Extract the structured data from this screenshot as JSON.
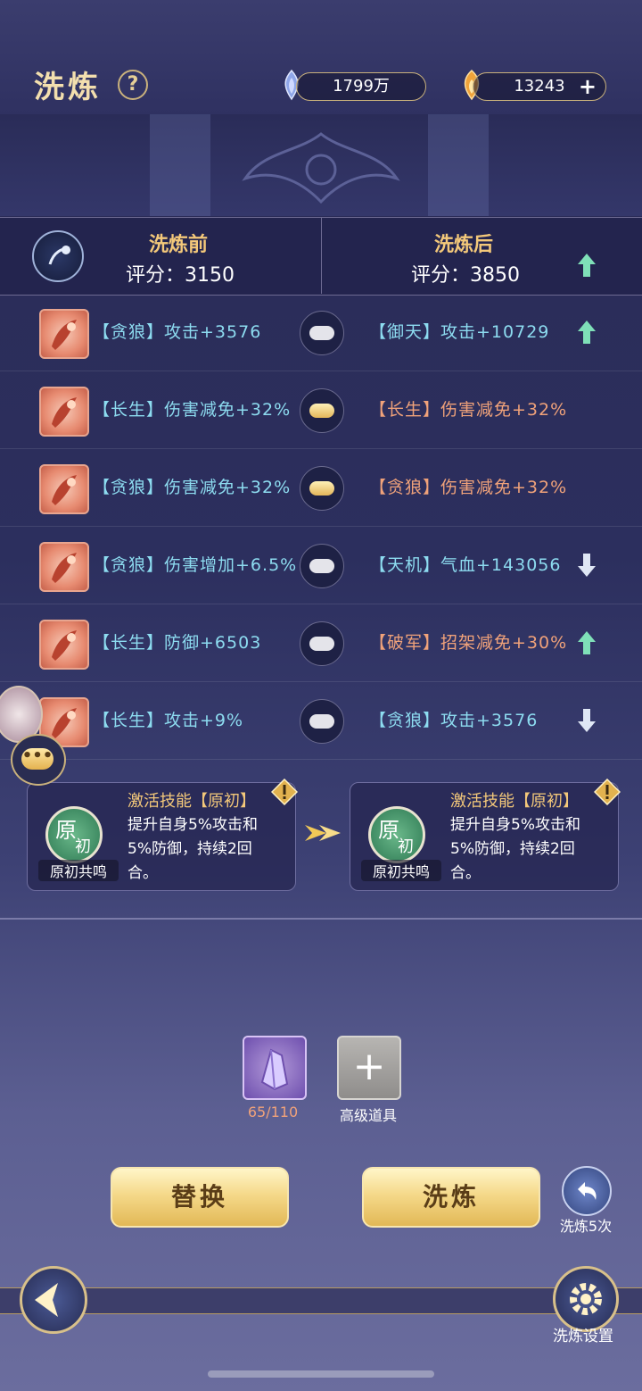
{
  "header": {
    "title": "洗炼",
    "help_glyph": "?",
    "currency1": {
      "icon": "moon-crystal-icon",
      "value": "1799万"
    },
    "currency2": {
      "icon": "flame-gem-icon",
      "value": "13243",
      "add_glyph": "+"
    }
  },
  "compare": {
    "before_title": "洗炼前",
    "after_title": "洗炼后",
    "before_score": "评分：3150",
    "after_score": "评分：3850",
    "score_trend": "up"
  },
  "rows": [
    {
      "left_tag": "【贪狼】",
      "left_text": "攻击+3576",
      "lock": "unlocked",
      "right_tag": "【御天】",
      "right_text": "攻击+10729",
      "right_tag_color": "#8ddcf0",
      "trend": "up"
    },
    {
      "left_tag": "【长生】",
      "left_text": "伤害减免+32%",
      "lock": "locked",
      "right_tag": "【长生】",
      "right_text": "伤害减免+32%",
      "right_tag_color": "#f0a27a",
      "trend": "none"
    },
    {
      "left_tag": "【贪狼】",
      "left_text": "伤害减免+32%",
      "lock": "locked",
      "right_tag": "【贪狼】",
      "right_text": "伤害减免+32%",
      "right_tag_color": "#f0a27a",
      "trend": "none"
    },
    {
      "left_tag": "【贪狼】",
      "left_text": "伤害增加+6.5%",
      "lock": "unlocked",
      "right_tag": "【天机】",
      "right_text": "气血+143056",
      "right_tag_color": "#8ddcf0",
      "trend": "down"
    },
    {
      "left_tag": "【长生】",
      "left_text": "防御+6503",
      "lock": "unlocked",
      "right_tag": "【破军】",
      "right_text": "招架减免+30%",
      "right_tag_color": "#f0a27a",
      "trend": "up"
    },
    {
      "left_tag": "【长生】",
      "left_text": "攻击+9%",
      "lock": "unlocked",
      "right_tag": "【贪狼】",
      "right_text": "攻击+3576",
      "right_tag_color": "#8ddcf0",
      "trend": "down"
    }
  ],
  "skills": {
    "before": {
      "badge_top": "原",
      "badge_bottom": "初",
      "name": "原初共鸣",
      "title": "激活技能【原初】",
      "desc": "提升自身5%攻击和5%防御，持续2回合。"
    },
    "after": {
      "badge_top": "原",
      "badge_bottom": "初",
      "name": "原初共鸣",
      "title": "激活技能【原初】",
      "desc": "提升自身5%攻击和5%防御，持续2回合。"
    }
  },
  "materials": {
    "crystal_count": "65/110",
    "advanced_label": "高级道具",
    "advanced_glyph": "+"
  },
  "actions": {
    "replace_label": "替换",
    "refine_label": "洗炼",
    "refine5_label": "洗炼5次",
    "settings_label": "洗炼设置"
  },
  "chat_glyph": "•••",
  "colors": {
    "gold": "#f3c87a",
    "up_arrow": "#7fe0b8",
    "down_arrow": "#dfe7f5"
  }
}
